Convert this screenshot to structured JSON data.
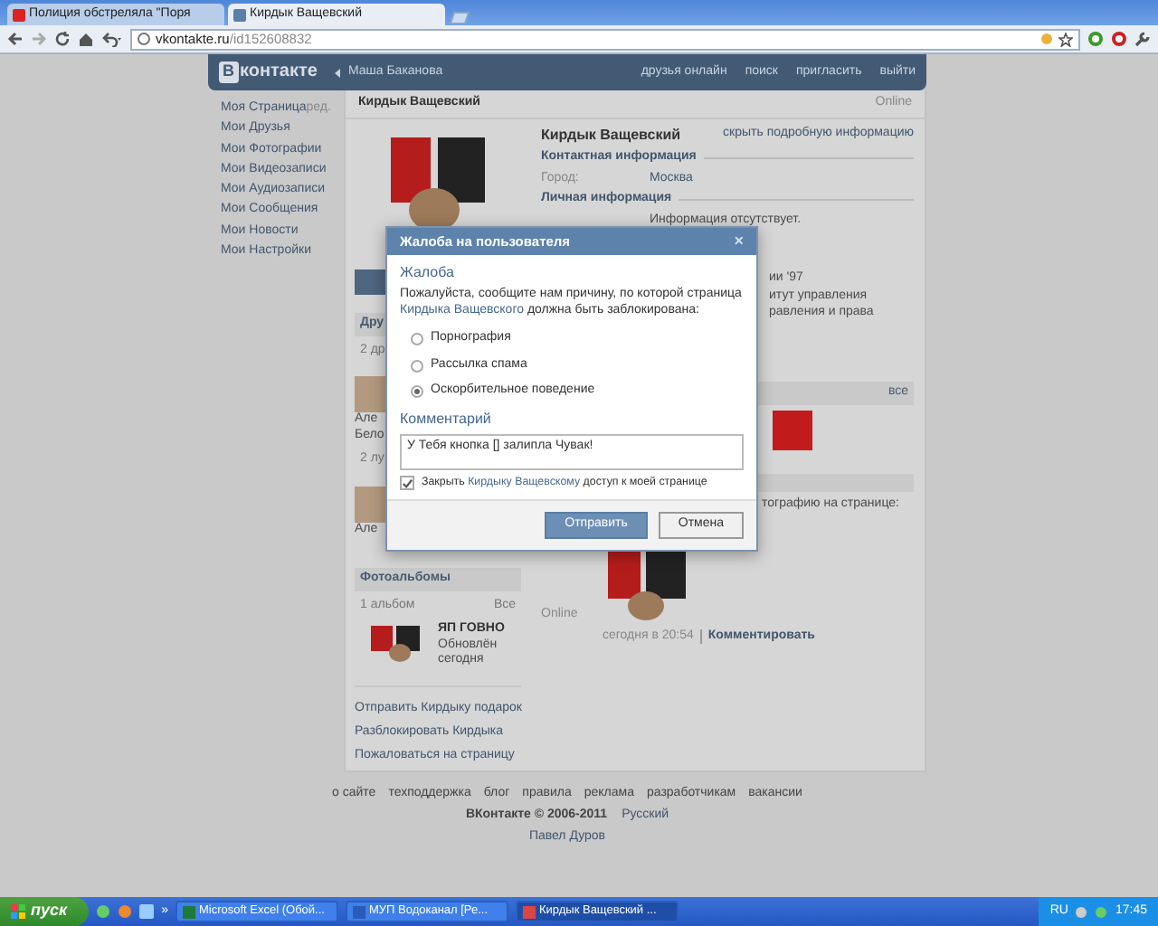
{
  "browser": {
    "tabs": [
      {
        "title": "Полиция обстреляла \"Поря",
        "selected": false
      },
      {
        "title": "Кирдык Ващевский",
        "selected": true
      }
    ],
    "address": {
      "host": "vkontakte.ru",
      "path": "/id152608832"
    }
  },
  "header": {
    "logo_mark": "В",
    "logo": "контакте",
    "back_link": "Маша Баканова",
    "nav": [
      "друзья онлайн",
      "поиск",
      "пригласить",
      "выйти"
    ]
  },
  "left_menu": [
    {
      "label": "Моя Страница",
      "extra": "ред."
    },
    {
      "label": "Мои Друзья"
    },
    {
      "label": "Мои Фотографии"
    },
    {
      "label": "Мои Видеозаписи"
    },
    {
      "label": "Мои Аудиозаписи"
    },
    {
      "label": "Мои Сообщения"
    },
    {
      "label": "Мои Новости"
    },
    {
      "label": "Мои Настройки"
    }
  ],
  "profile": {
    "title": "Кирдык Ващевский",
    "status": "Online",
    "friends": {
      "header": "Дру",
      "count": "2 др",
      "names": [
        "Але",
        "Бело"
      ]
    },
    "best_friends": {
      "count": "2 лу",
      "names": [
        "Але"
      ]
    },
    "albums": {
      "header": "Фотоальбомы",
      "count": "1 альбом",
      "all": "Все",
      "album_title": "ЯП ГОВНО",
      "album_line1": "Обновлён",
      "album_line2": "сегодня"
    },
    "actions": [
      "Отправить Кирдыку подарок",
      "Разблокировать Кирдыка",
      "Пожаловаться на страницу"
    ],
    "name": "Кирдык Ващевский",
    "hide_link": "скрыть подробную информацию",
    "contact_header": "Контактная информация",
    "city_label": "Город:",
    "city": "Москва",
    "personal_header": "Личная информация",
    "personal_text": "Информация отсутствует.",
    "fragments": [
      "ии '97",
      "итут управления",
      "равления и права"
    ],
    "photos_all": "все",
    "wall_fragment": "тографию на странице:",
    "wall_status": "Online",
    "wall_time": "сегодня в 20:54",
    "wall_comment": "Комментировать"
  },
  "dialog": {
    "title": "Жалоба на пользователя",
    "close": "×",
    "section": "Жалоба",
    "text_before": "Пожалуйста, сообщите нам причину, по которой страница ",
    "text_link": "Кирдыка Ващевского",
    "text_after": " должна быть заблокирована:",
    "reasons": [
      {
        "label": "Порнография",
        "selected": false
      },
      {
        "label": "Рассылка спама",
        "selected": false
      },
      {
        "label": "Оскорбительное поведение",
        "selected": true
      }
    ],
    "comment_label": "Комментарий",
    "comment": "У Тебя кнопка [] залипла Чувак!",
    "block": {
      "checked": true,
      "before": "Закрыть ",
      "link": "Кирдыку Ващевскому",
      "after": " доступ к моей странице"
    },
    "buttons": [
      {
        "label": "Отправить",
        "kind": "primary"
      },
      {
        "label": "Отмена",
        "kind": "secondary"
      }
    ]
  },
  "footer": {
    "links": [
      "о сайте",
      "техподдержка",
      "блог",
      "правила",
      "реклама",
      "разработчикам",
      "вакансии"
    ],
    "copyright": "ВКонтакте © 2006-2011",
    "language": "Русский",
    "author": "Павел Дуров"
  },
  "taskbar": {
    "start": "пуск",
    "more": "»",
    "tasks": [
      {
        "title": "Microsoft Excel (Обой...",
        "selected": false
      },
      {
        "title": "МУП Водоканал [Ре...",
        "selected": false
      },
      {
        "title": "Кирдык Ващевский ...",
        "selected": true
      }
    ],
    "lang": "RU",
    "clock": "17:45"
  }
}
